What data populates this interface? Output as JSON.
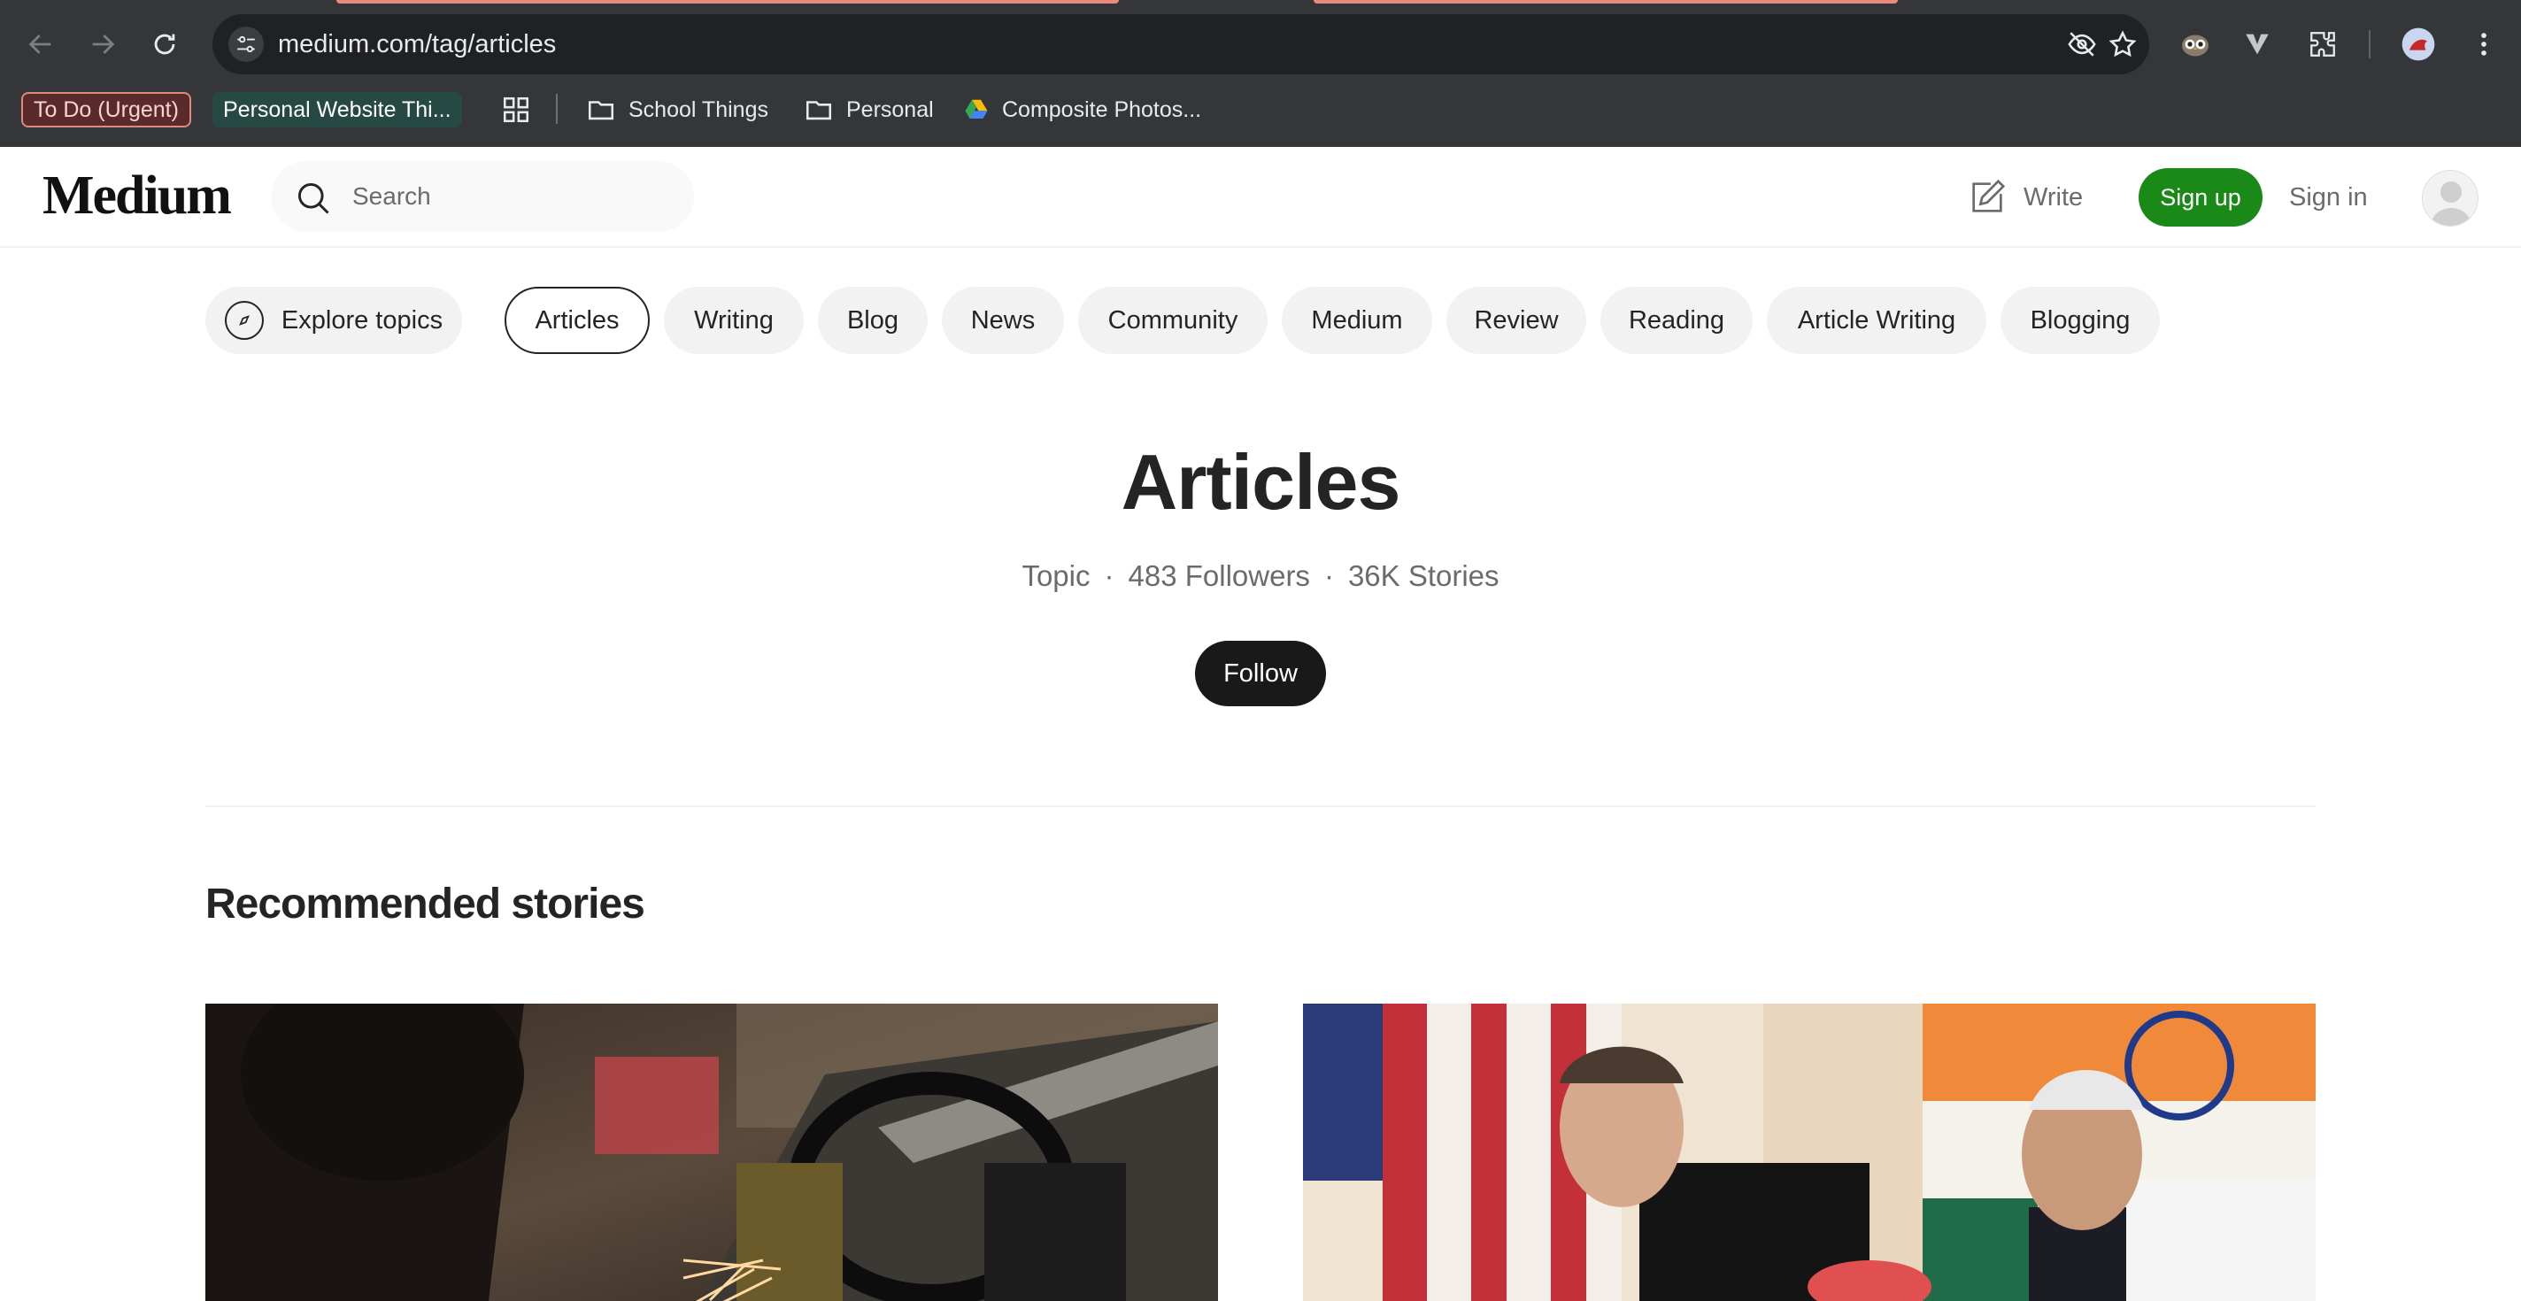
{
  "browser": {
    "url": "medium.com/tag/articles",
    "bookmarks": [
      {
        "label": "To Do (Urgent)",
        "style": "red-tag"
      },
      {
        "label": "Personal Website Thi...",
        "style": "green-tag"
      },
      {
        "label": "School Things",
        "icon": "folder-icon"
      },
      {
        "label": "Personal",
        "icon": "folder-icon"
      },
      {
        "label": "Composite Photos...",
        "icon": "google-drive-icon"
      }
    ]
  },
  "header": {
    "logo": "Medium",
    "search_placeholder": "Search",
    "write_label": "Write",
    "signup_label": "Sign up",
    "signin_label": "Sign in"
  },
  "topics": {
    "explore_label": "Explore topics",
    "pills": [
      "Articles",
      "Writing",
      "Blog",
      "News",
      "Community",
      "Medium",
      "Review",
      "Reading",
      "Article Writing",
      "Blogging"
    ],
    "active": "Articles"
  },
  "topic": {
    "title": "Articles",
    "kind": "Topic",
    "followers": "483 Followers",
    "stories": "36K Stories",
    "follow_label": "Follow"
  },
  "recommended": {
    "heading": "Recommended stories"
  },
  "colors": {
    "brand_green": "#1a8917",
    "chrome_bg": "#35363a",
    "text_primary": "#242424",
    "text_secondary": "#6b6b6b"
  }
}
